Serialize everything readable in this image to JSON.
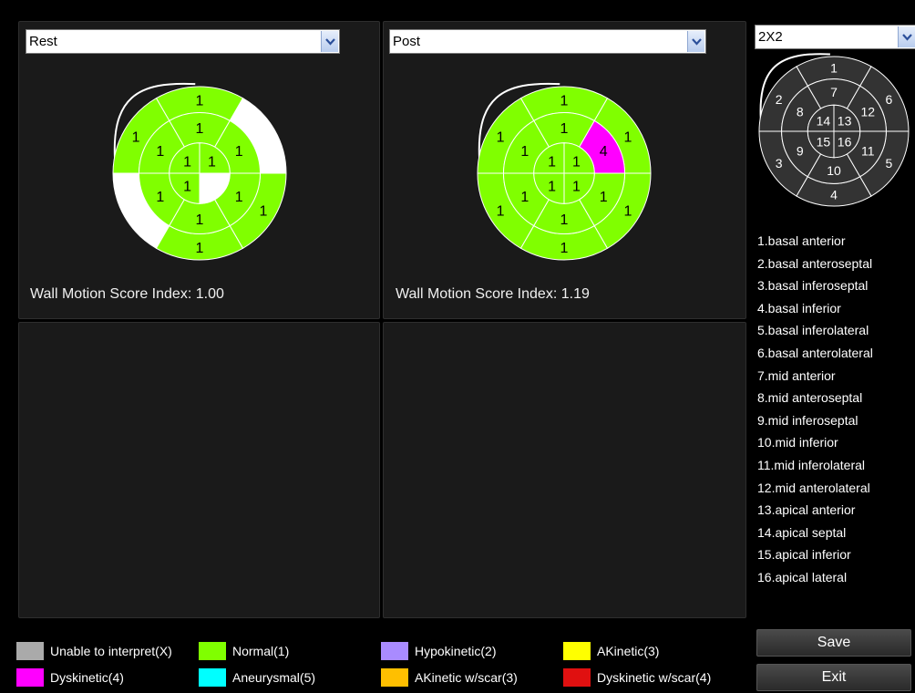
{
  "views": [
    {
      "id": "rest",
      "select_value": "Rest",
      "wmsi_label": "Wall Motion Score Index:",
      "wmsi_value": "1.00",
      "segments": {
        "1": "1",
        "2": "1",
        "3": "",
        "4": "1",
        "5": "1",
        "6": "",
        "7": "1",
        "8": "1",
        "9": "1",
        "10": "1",
        "11": "1",
        "12": "1",
        "13": "1",
        "14": "1",
        "15": "1",
        "16": ""
      },
      "segment_colors": {
        "1": "#80ff00",
        "2": "#80ff00",
        "3": "#ffffff",
        "4": "#80ff00",
        "5": "#80ff00",
        "6": "#ffffff",
        "7": "#80ff00",
        "8": "#80ff00",
        "9": "#80ff00",
        "10": "#80ff00",
        "11": "#80ff00",
        "12": "#80ff00",
        "13": "#80ff00",
        "14": "#80ff00",
        "15": "#80ff00",
        "16": "#ffffff"
      }
    },
    {
      "id": "post",
      "select_value": "Post",
      "wmsi_label": "Wall Motion Score Index:",
      "wmsi_value": "1.19",
      "segments": {
        "1": "1",
        "2": "1",
        "3": "1",
        "4": "1",
        "5": "1",
        "6": "1",
        "7": "1",
        "8": "1",
        "9": "1",
        "10": "1",
        "11": "1",
        "12": "4",
        "13": "1",
        "14": "1",
        "15": "1",
        "16": "1"
      },
      "segment_colors": {
        "1": "#80ff00",
        "2": "#80ff00",
        "3": "#80ff00",
        "4": "#80ff00",
        "5": "#80ff00",
        "6": "#80ff00",
        "7": "#80ff00",
        "8": "#80ff00",
        "9": "#80ff00",
        "10": "#80ff00",
        "11": "#80ff00",
        "12": "#ff00ff",
        "13": "#80ff00",
        "14": "#80ff00",
        "15": "#80ff00",
        "16": "#80ff00"
      }
    }
  ],
  "layout_select": {
    "value": "2X2"
  },
  "reference": {
    "segment_numbers": [
      "1",
      "2",
      "3",
      "4",
      "5",
      "6",
      "7",
      "8",
      "9",
      "10",
      "11",
      "12",
      "13",
      "14",
      "15",
      "16"
    ]
  },
  "segment_names": [
    "1.basal anterior",
    "2.basal anteroseptal",
    "3.basal inferoseptal",
    "4.basal inferior",
    "5.basal inferolateral",
    "6.basal anterolateral",
    "7.mid anterior",
    "8.mid anteroseptal",
    "9.mid inferoseptal",
    "10.mid inferior",
    "11.mid inferolateral",
    "12.mid anterolateral",
    "13.apical anterior",
    "14.apical septal",
    "15.apical inferior",
    "16.apical lateral"
  ],
  "legend": [
    {
      "label": "Unable to interpret(X)",
      "color": "#aaaaaa"
    },
    {
      "label": "Normal(1)",
      "color": "#80ff00"
    },
    {
      "label": "Hypokinetic(2)",
      "color": "#a98bff"
    },
    {
      "label": "AKinetic(3)",
      "color": "#ffff00"
    },
    {
      "label": "Dyskinetic(4)",
      "color": "#ff00ff"
    },
    {
      "label": "Aneurysmal(5)",
      "color": "#00ffff"
    },
    {
      "label": "AKinetic w/scar(3)",
      "color": "#ffbf00"
    },
    {
      "label": "Dyskinetic w/scar(4)",
      "color": "#e01010"
    }
  ],
  "buttons": {
    "save": "Save",
    "exit": "Exit"
  }
}
